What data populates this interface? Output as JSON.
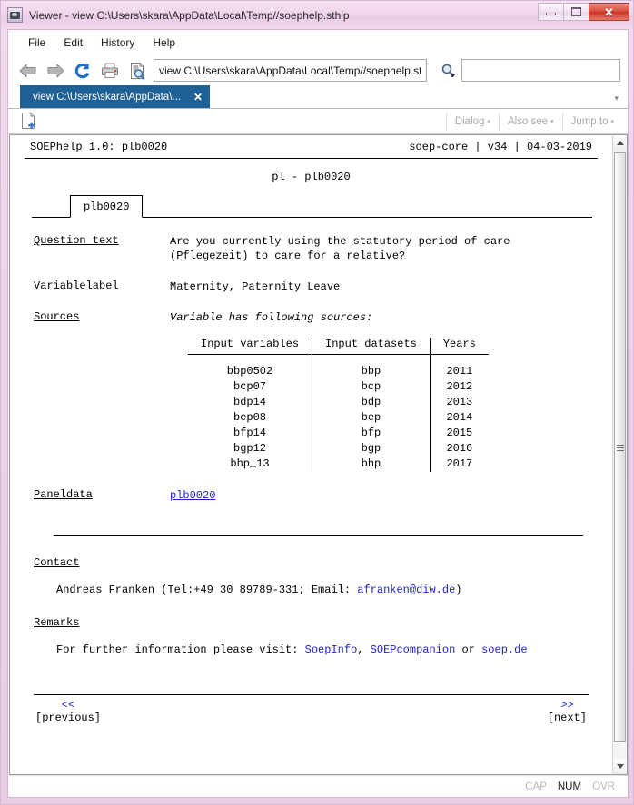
{
  "window": {
    "title": "Viewer - view C:\\Users\\skara\\AppData\\Local\\Temp//soephelp.sthlp",
    "icon": "viewer-icon",
    "buttons": {
      "minimize": "minimize-icon",
      "maximize": "maximize-icon",
      "close": "✕"
    }
  },
  "menubar": {
    "items": [
      {
        "label": "File"
      },
      {
        "label": "Edit"
      },
      {
        "label": "History"
      },
      {
        "label": "Help"
      }
    ]
  },
  "toolbar": {
    "back_icon": "back-arrow-icon",
    "forward_icon": "forward-arrow-icon",
    "refresh_icon": "refresh-icon",
    "print_icon": "print-icon",
    "find_icon": "find-in-document-icon",
    "address_value": "view C:\\Users\\skara\\AppData\\Local\\Temp//soephelp.sthlp",
    "address_placeholder": "",
    "search_icon": "search-magnifier-icon",
    "search_value": "",
    "search_placeholder": ""
  },
  "tabstrip": {
    "tab_label": "view C:\\Users\\skara\\AppData\\...",
    "tab_close": "✕",
    "overflow_caret": "▾"
  },
  "viewer_header": {
    "new_doc_icon": "new-document-icon",
    "buttons": [
      {
        "label": "Dialog",
        "caret": "▾"
      },
      {
        "label": "Also see",
        "caret": "▾"
      },
      {
        "label": "Jump to",
        "caret": "▾"
      }
    ]
  },
  "document": {
    "header_left": "SOEPhelp 1.0: plb0020",
    "header_right": "soep-core | v34 | 04-03-2019",
    "title": "pl - plb0020",
    "subtab": "plb0020",
    "fields": [
      {
        "label": "Question text",
        "lines": [
          "Are you currently using the statutory period of care",
          "(Pflegezeit) to care for a relative?"
        ]
      },
      {
        "label": "Variablelabel",
        "lines": [
          "Maternity, Paternity Leave"
        ]
      },
      {
        "label": "Sources",
        "lines": [
          "Variable has following sources:"
        ]
      }
    ],
    "sources_table": {
      "headers": [
        "Input variables",
        "Input datasets",
        "Years"
      ],
      "rows": [
        [
          "bbp0502",
          "bbp",
          "2011"
        ],
        [
          "bcp07",
          "bcp",
          "2012"
        ],
        [
          "bdp14",
          "bdp",
          "2013"
        ],
        [
          "bep08",
          "bep",
          "2014"
        ],
        [
          "bfp14",
          "bfp",
          "2015"
        ],
        [
          "bgp12",
          "bgp",
          "2016"
        ],
        [
          "bhp_13",
          "bhp",
          "2017"
        ]
      ]
    },
    "paneldata": {
      "label": "Paneldata",
      "link": "plb0020"
    },
    "contact": {
      "heading": "Contact",
      "text_before": "Andreas Franken (Tel:+49 30 89789-331; Email: ",
      "email": "afranken@diw.de",
      "text_after": ")"
    },
    "remarks": {
      "heading": "Remarks",
      "text_before": "For further information please visit: ",
      "link1": "SoepInfo",
      "sep1": ", ",
      "link2": "SOEPcompanion",
      "sep2": " or ",
      "link3": "soep.de"
    },
    "nav": {
      "prev_arrows": "<<",
      "prev_label": "[previous]",
      "next_arrows": ">>",
      "next_label": "[next]"
    }
  },
  "scrollbar": {
    "up": "scroll-up-arrow",
    "down": "scroll-down-arrow"
  },
  "statusbar": {
    "cap": "CAP",
    "num": "NUM",
    "ovr": "OVR"
  },
  "colors": {
    "frame": "#eed5ea",
    "tab_active": "#1f6095",
    "link": "#2222cc",
    "close_button": "#c93326"
  }
}
